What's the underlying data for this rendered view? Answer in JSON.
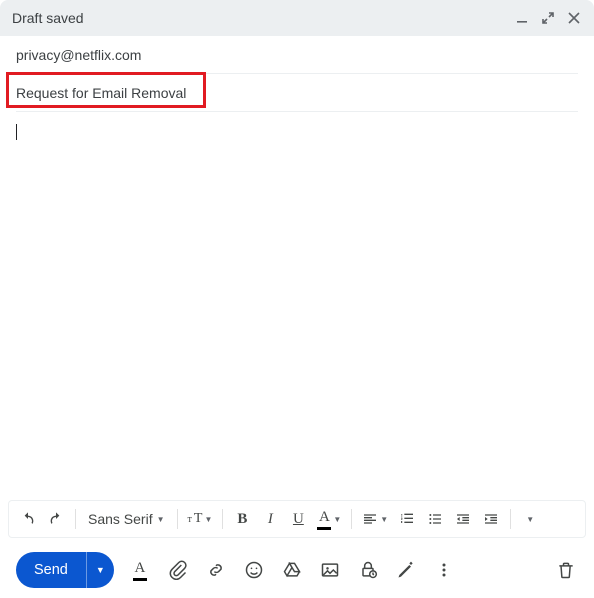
{
  "header": {
    "title": "Draft saved"
  },
  "fields": {
    "to": "privacy@netflix.com",
    "subject": "Request for Email Removal"
  },
  "toolbar": {
    "font": "Sans Serif"
  },
  "actions": {
    "send_label": "Send"
  }
}
